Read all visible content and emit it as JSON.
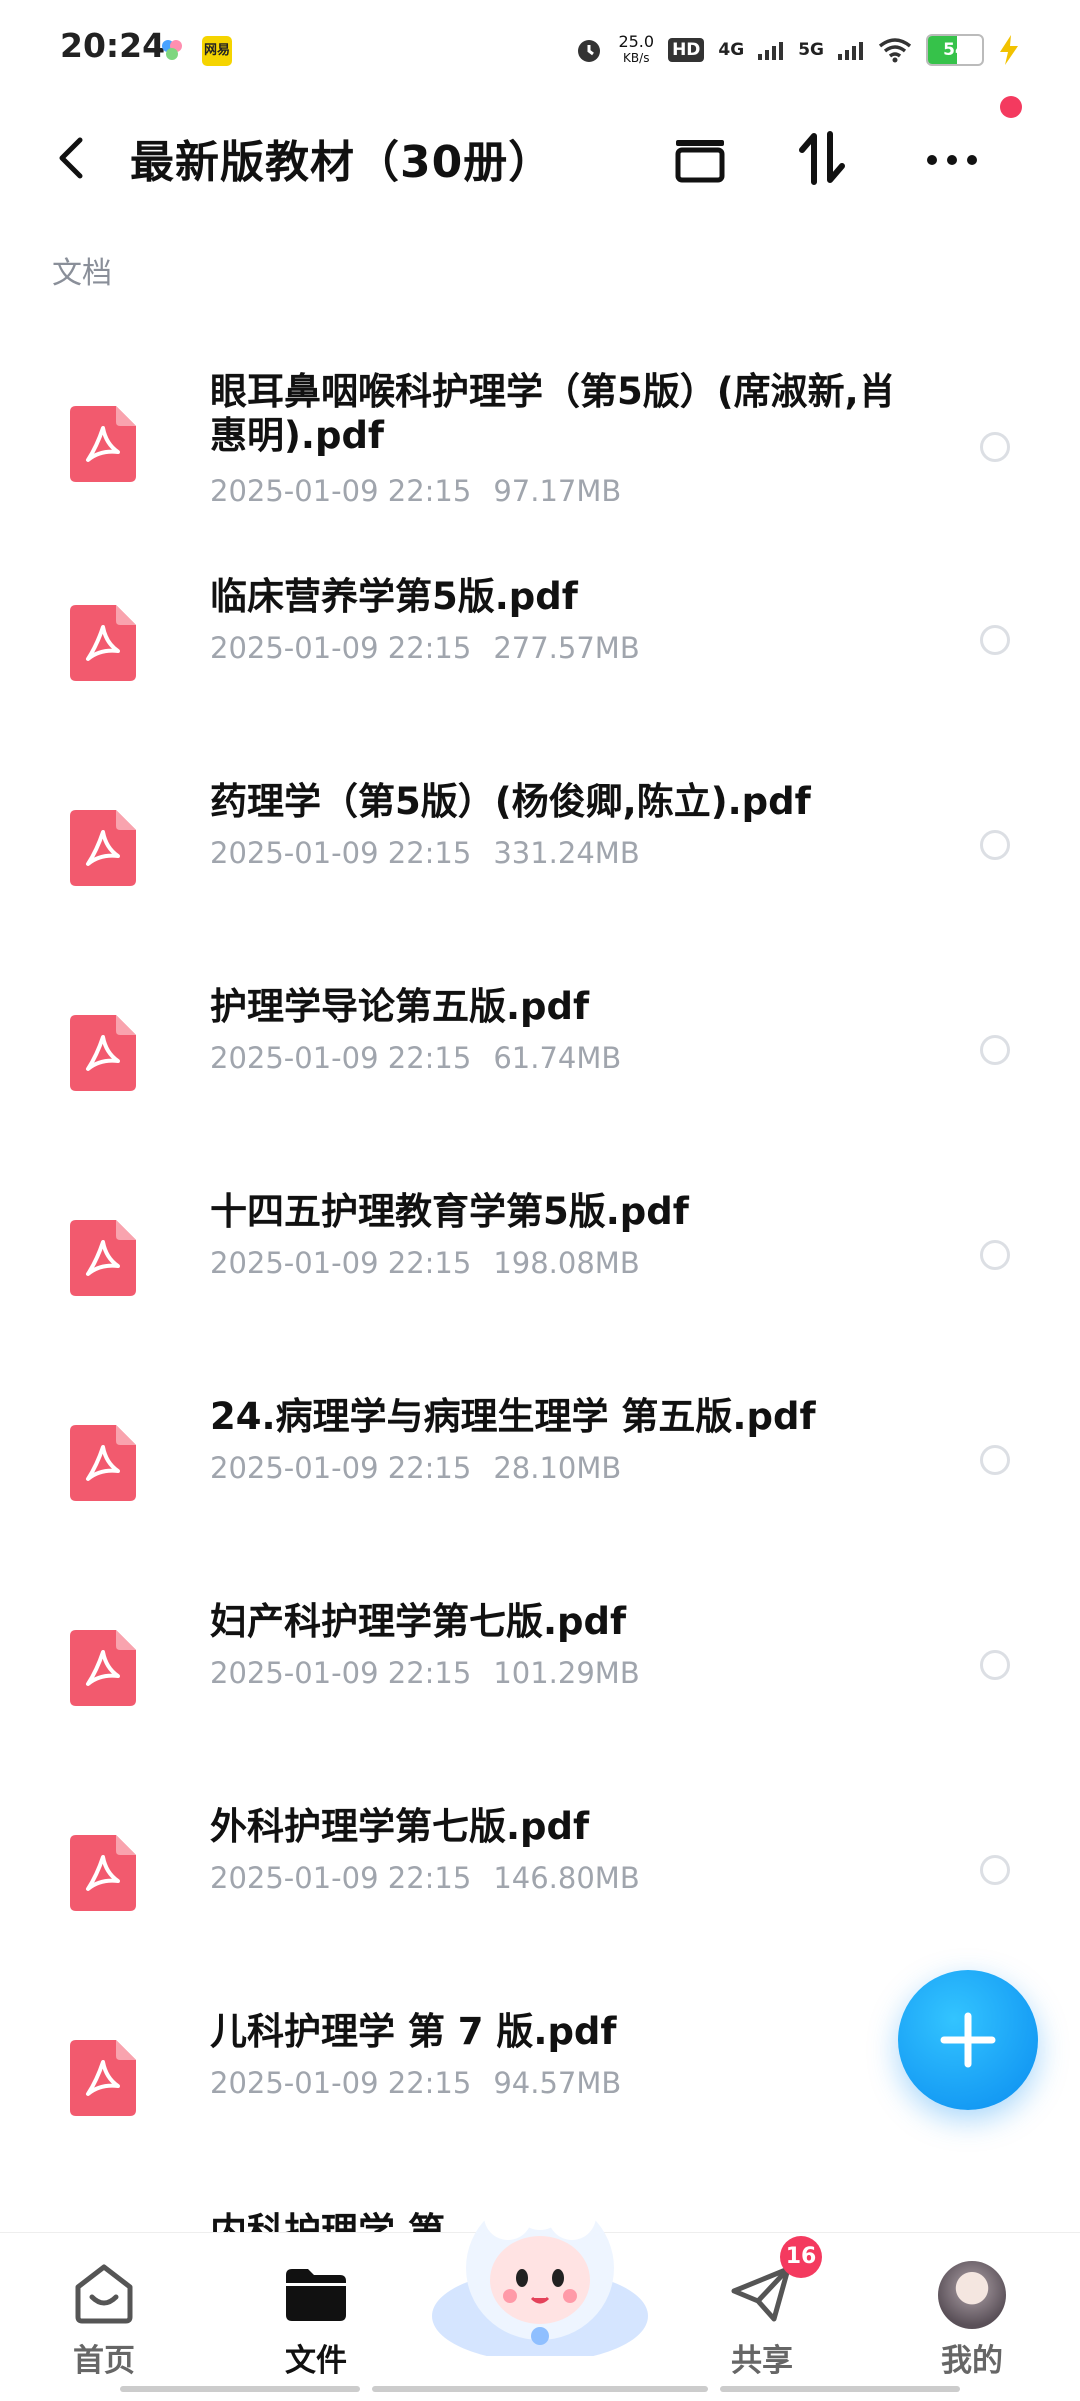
{
  "status_bar": {
    "time": "20:24",
    "app2_label": "网易",
    "speed_value": "25.0",
    "speed_unit": "KB/s",
    "hd": "HD",
    "net1": "4G",
    "net2": "5G",
    "battery": "54",
    "battery_level": 0.54
  },
  "header": {
    "title": "最新版教材（30册）"
  },
  "section_label": "文档",
  "files": [
    {
      "name": "眼耳鼻咽喉科护理学（第5版）(席淑新,肖惠明).pdf",
      "date": "2025-01-09 22:15",
      "size": "97.17MB"
    },
    {
      "name": "临床营养学第5版.pdf",
      "date": "2025-01-09 22:15",
      "size": "277.57MB"
    },
    {
      "name": "药理学（第5版）(杨俊卿,陈立).pdf",
      "date": "2025-01-09 22:15",
      "size": "331.24MB"
    },
    {
      "name": "护理学导论第五版.pdf",
      "date": "2025-01-09 22:15",
      "size": "61.74MB"
    },
    {
      "name": "十四五护理教育学第5版.pdf",
      "date": "2025-01-09 22:15",
      "size": "198.08MB"
    },
    {
      "name": "24.病理学与病理生理学 第五版.pdf",
      "date": "2025-01-09 22:15",
      "size": "28.10MB"
    },
    {
      "name": "妇产科护理学第七版.pdf",
      "date": "2025-01-09 22:15",
      "size": "101.29MB"
    },
    {
      "name": "外科护理学第七版.pdf",
      "date": "2025-01-09 22:15",
      "size": "146.80MB"
    },
    {
      "name": "儿科护理学 第 7 版.pdf",
      "date": "2025-01-09 22:15",
      "size": "94.57MB"
    },
    {
      "name": "内科护理学 第",
      "date": "",
      "size": ""
    }
  ],
  "nav": {
    "home": "首页",
    "files": "文件",
    "share": "共享",
    "mine": "我的",
    "share_badge": "16"
  },
  "colors": {
    "accent": "#0a8cf0",
    "pdf_red": "#f25a6e",
    "badge_red": "#f43a5f"
  },
  "icons": [
    "back-arrow-icon",
    "archive-icon",
    "sort-icon",
    "more-icon",
    "pdf-file-icon",
    "radio-icon",
    "plus-icon",
    "home-icon",
    "folder-icon",
    "send-icon",
    "avatar"
  ]
}
